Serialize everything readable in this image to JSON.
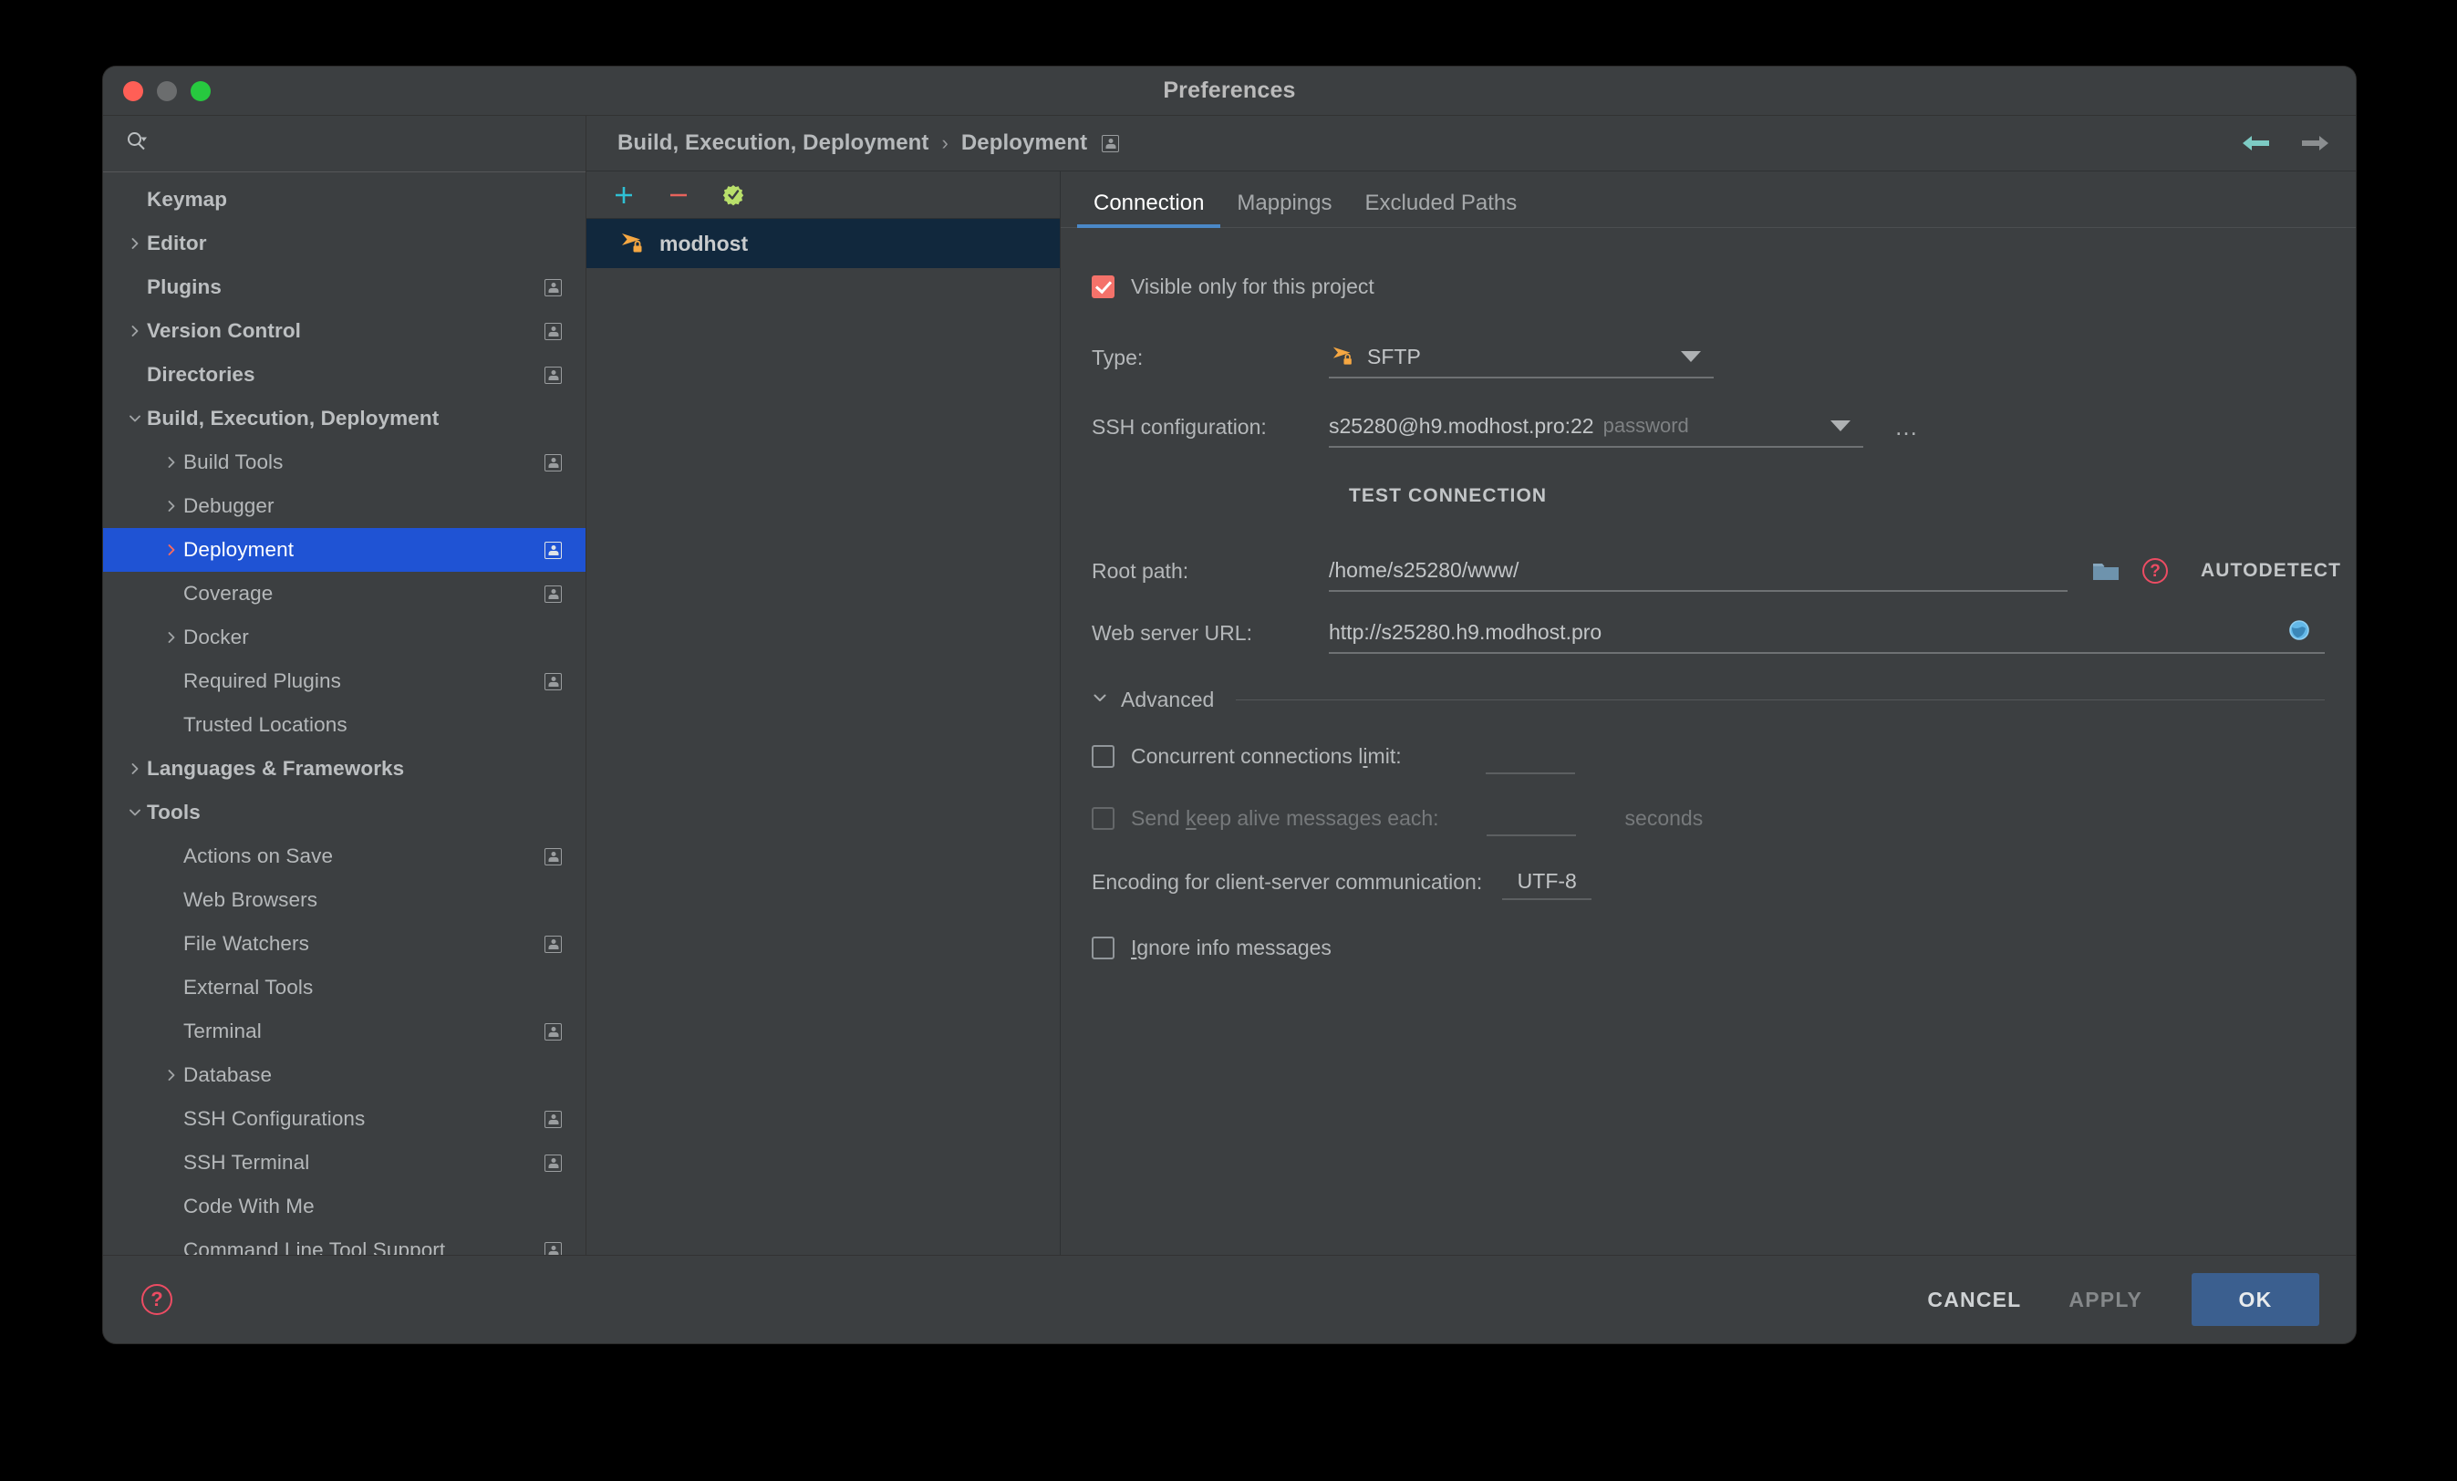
{
  "window": {
    "title": "Preferences",
    "traffic_lights": [
      "close",
      "minimize",
      "zoom"
    ]
  },
  "sidebar": {
    "search": {
      "value": "",
      "placeholder": ""
    },
    "items": [
      {
        "label": "Keymap",
        "level": 0,
        "arrow": "none",
        "bold": true,
        "badge": false,
        "selected": false
      },
      {
        "label": "Editor",
        "level": 0,
        "arrow": "right",
        "bold": true,
        "badge": false,
        "selected": false
      },
      {
        "label": "Plugins",
        "level": 0,
        "arrow": "none",
        "bold": true,
        "badge": true,
        "selected": false
      },
      {
        "label": "Version Control",
        "level": 0,
        "arrow": "right",
        "bold": true,
        "badge": true,
        "selected": false
      },
      {
        "label": "Directories",
        "level": 0,
        "arrow": "none",
        "bold": true,
        "badge": true,
        "selected": false
      },
      {
        "label": "Build, Execution, Deployment",
        "level": 0,
        "arrow": "down",
        "bold": true,
        "badge": false,
        "selected": false
      },
      {
        "label": "Build Tools",
        "level": 1,
        "arrow": "right",
        "bold": false,
        "badge": true,
        "selected": false
      },
      {
        "label": "Debugger",
        "level": 1,
        "arrow": "right",
        "bold": false,
        "badge": false,
        "selected": false
      },
      {
        "label": "Deployment",
        "level": 1,
        "arrow": "right",
        "bold": false,
        "badge": true,
        "selected": true
      },
      {
        "label": "Coverage",
        "level": 1,
        "arrow": "none",
        "bold": false,
        "badge": true,
        "selected": false
      },
      {
        "label": "Docker",
        "level": 1,
        "arrow": "right",
        "bold": false,
        "badge": false,
        "selected": false
      },
      {
        "label": "Required Plugins",
        "level": 1,
        "arrow": "none",
        "bold": false,
        "badge": true,
        "selected": false
      },
      {
        "label": "Trusted Locations",
        "level": 1,
        "arrow": "none",
        "bold": false,
        "badge": false,
        "selected": false
      },
      {
        "label": "Languages & Frameworks",
        "level": 0,
        "arrow": "right",
        "bold": true,
        "badge": false,
        "selected": false
      },
      {
        "label": "Tools",
        "level": 0,
        "arrow": "down",
        "bold": true,
        "badge": false,
        "selected": false
      },
      {
        "label": "Actions on Save",
        "level": 1,
        "arrow": "none",
        "bold": false,
        "badge": true,
        "selected": false
      },
      {
        "label": "Web Browsers",
        "level": 1,
        "arrow": "none",
        "bold": false,
        "badge": false,
        "selected": false
      },
      {
        "label": "File Watchers",
        "level": 1,
        "arrow": "none",
        "bold": false,
        "badge": true,
        "selected": false
      },
      {
        "label": "External Tools",
        "level": 1,
        "arrow": "none",
        "bold": false,
        "badge": false,
        "selected": false
      },
      {
        "label": "Terminal",
        "level": 1,
        "arrow": "none",
        "bold": false,
        "badge": true,
        "selected": false
      },
      {
        "label": "Database",
        "level": 1,
        "arrow": "right",
        "bold": false,
        "badge": false,
        "selected": false
      },
      {
        "label": "SSH Configurations",
        "level": 1,
        "arrow": "none",
        "bold": false,
        "badge": true,
        "selected": false
      },
      {
        "label": "SSH Terminal",
        "level": 1,
        "arrow": "none",
        "bold": false,
        "badge": true,
        "selected": false
      },
      {
        "label": "Code With Me",
        "level": 1,
        "arrow": "none",
        "bold": false,
        "badge": false,
        "selected": false
      },
      {
        "label": "Command Line Tool Support",
        "level": 1,
        "arrow": "none",
        "bold": false,
        "badge": true,
        "selected": false
      }
    ]
  },
  "breadcrumb": {
    "parent": "Build, Execution, Deployment",
    "separator": "›",
    "current": "Deployment"
  },
  "nav": {
    "back_enabled": true,
    "forward_enabled": false
  },
  "host_toolbar": {
    "add_label": "+",
    "remove_label": "−",
    "set_default_label": "Use as default"
  },
  "hosts": [
    {
      "name": "modhost",
      "type_icon": "sftp-icon",
      "selected": true
    }
  ],
  "tabs": [
    {
      "label": "Connection",
      "active": true
    },
    {
      "label": "Mappings",
      "active": false
    },
    {
      "label": "Excluded Paths",
      "active": false
    }
  ],
  "connection": {
    "visible_only_label": "Visible only for this project",
    "visible_only_checked": true,
    "type_label": "Type:",
    "type_value": "SFTP",
    "ssh_config_label": "SSH configuration:",
    "ssh_config_value": "s25280@h9.modhost.pro:22",
    "ssh_config_auth": "password",
    "ssh_config_more": "…",
    "test_connection_label": "TEST CONNECTION",
    "root_path_label": "Root path:",
    "root_path_value": "/home/s25280/www/",
    "autodetect_label": "AUTODETECT",
    "web_url_label": "Web server URL:",
    "web_url_value": "http://s25280.h9.modhost.pro",
    "advanced_label": "Advanced",
    "concurrent_label_pre": "Concurrent connections l",
    "concurrent_label_mn": "i",
    "concurrent_label_post": "mit:",
    "concurrent_checked": false,
    "concurrent_value": "",
    "keepalive_label_pre": "Send ",
    "keepalive_label_mn": "k",
    "keepalive_label_post": "eep alive messages each:",
    "keepalive_checked": false,
    "keepalive_value": "",
    "keepalive_units": "seconds",
    "encoding_label": "Encoding for client-server communication:",
    "encoding_value": "UTF-8",
    "ignore_label_mn": "I",
    "ignore_label_post": "gnore info messages",
    "ignore_checked": false
  },
  "footer": {
    "help_label": "?",
    "cancel_label": "CANCEL",
    "apply_label": "APPLY",
    "apply_enabled": false,
    "ok_label": "OK"
  },
  "colors": {
    "window_bg": "#3c3f41",
    "selection_blue": "#1f53d4",
    "host_selection": "#11283d",
    "accent_red": "#f4726a",
    "sftp_orange": "#f5a742",
    "tab_underline": "#4a88c7",
    "ok_button": "#3b5f8f",
    "help_red": "#ec4c63"
  }
}
